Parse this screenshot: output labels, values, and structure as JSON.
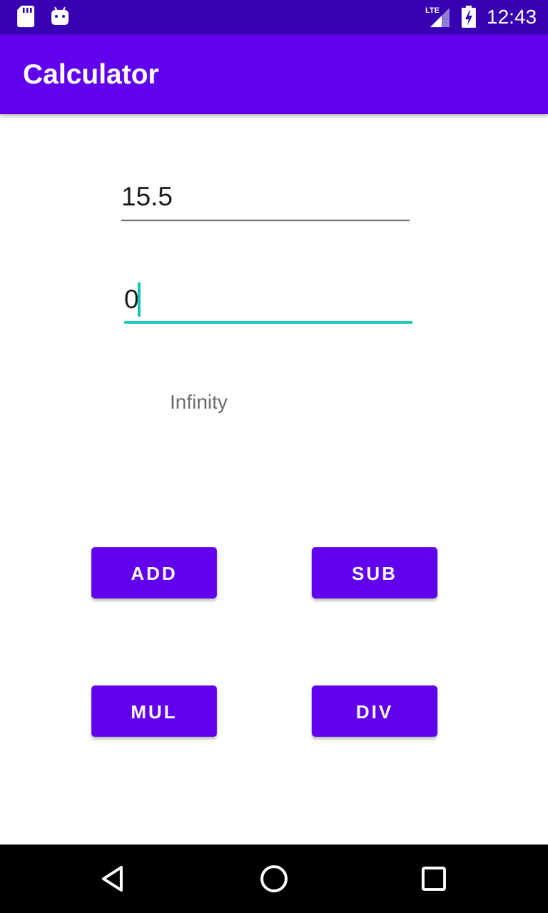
{
  "status_bar": {
    "network_label": "LTE",
    "time": "12:43",
    "icons": [
      "sd-card-icon",
      "android-icon",
      "lte-signal-icon",
      "battery-charging-icon"
    ]
  },
  "app_bar": {
    "title": "Calculator"
  },
  "inputs": {
    "first_number": "15.5",
    "second_number": "0"
  },
  "result": {
    "text": "Infinity"
  },
  "buttons": {
    "add": "ADD",
    "sub": "SUB",
    "mul": "MUL",
    "div": "DIV"
  },
  "navigation": {
    "icons": [
      "back-icon",
      "home-icon",
      "recent-apps-icon"
    ]
  },
  "colors": {
    "status_bar": "#3700b3",
    "primary": "#6200ee",
    "accent": "#1cc8b8",
    "nav_bar": "#000000"
  }
}
